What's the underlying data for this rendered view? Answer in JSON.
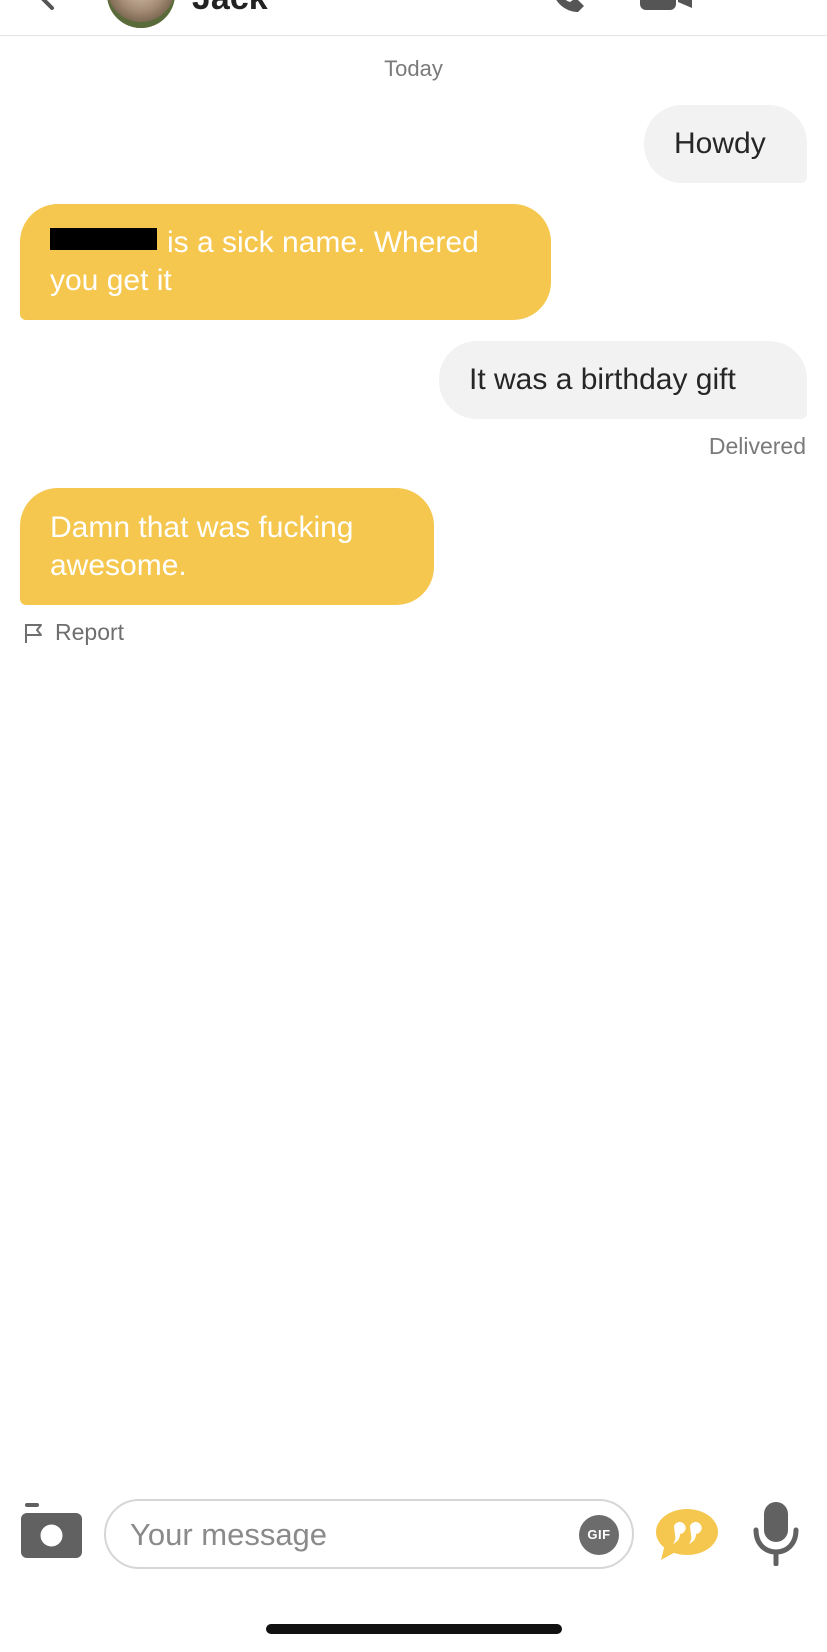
{
  "header": {
    "contact_name": "Jack",
    "icons": {
      "back": "chevron-left-icon",
      "call": "phone-icon",
      "video": "video-camera-icon",
      "more": "more-vertical-icon"
    }
  },
  "chat": {
    "day_label": "Today",
    "messages": [
      {
        "direction": "outgoing",
        "text": "Howdy"
      },
      {
        "direction": "incoming",
        "text": "is a sick name. Whered you get it",
        "redacted_prefix": true
      },
      {
        "direction": "outgoing",
        "text": "It was a birthday gift"
      },
      {
        "direction": "incoming",
        "text": "Damn that was fucking awesome."
      }
    ],
    "delivered_label": "Delivered",
    "report_label": "Report"
  },
  "composer": {
    "placeholder": "Your message",
    "value": "",
    "gif_label": "GIF",
    "icons": {
      "camera": "camera-icon",
      "quote": "quote-bubble-icon",
      "mic": "microphone-icon"
    }
  },
  "colors": {
    "incoming_bubble": "#f5c74f",
    "outgoing_bubble": "#f2f2f2",
    "accent": "#f5c74f"
  }
}
